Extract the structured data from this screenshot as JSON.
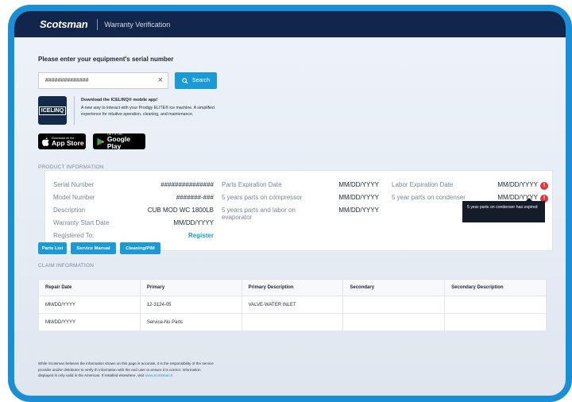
{
  "header": {
    "logo": "Scotsman",
    "title": "Warranty Verification"
  },
  "search": {
    "prompt": "Please enter your equipment's serial number",
    "value": "##############",
    "clear_icon": "×",
    "button_label": "Search"
  },
  "promo": {
    "logo_text": "ICELINQ",
    "title": "Download the ICELINQ® mobile app!",
    "text": "A new way to interact with your Prodigy ELITE® ice machine. A simplified experience for intuitive operation, cleaning, and maintenance.",
    "app_store_small": "Download on the",
    "app_store_big": "App Store",
    "google_small": "GET IT ON",
    "google_big": "Google Play"
  },
  "product": {
    "section_label": "PRODUCT INFORMATION",
    "col1": [
      {
        "label": "Serial Number",
        "value": "###############"
      },
      {
        "label": "Model Number",
        "value": "#######-###"
      },
      {
        "label": "Description",
        "value": "CUB MOD WC 1800LB"
      },
      {
        "label": "Warranty Start Date",
        "value": "MM/DD/YYYY"
      },
      {
        "label": "Registered To:",
        "value": "Register"
      }
    ],
    "col2": [
      {
        "label": "Parts Expiration Date",
        "value": "MM/DD/YYYY"
      },
      {
        "label": "5 years parts on compressor",
        "value": "MM/DD/YYYY"
      },
      {
        "label": "5 years parts and labor on",
        "label2": "evaporator",
        "value": "MM/DD/YYYY"
      }
    ],
    "col3": [
      {
        "label": "Labor Expiration Date",
        "value": "MM/DD/YYYY"
      },
      {
        "label": "5 year parts on condenser",
        "value": "MM/DD/YYYY"
      }
    ],
    "alert_icon": "!",
    "tooltip": "5 year parts on condenser has expired",
    "alert_color": "#e0353a"
  },
  "doc_buttons": [
    "Parts List",
    "Service Manual",
    "Cleaning/PIM"
  ],
  "claims": {
    "section_label": "CLAIM INFORMATION",
    "headers": [
      "Repair Date",
      "Primary",
      "Primary Description",
      "Secondary",
      "Secondary Description"
    ],
    "rows": [
      [
        "MM/DD/YYYY",
        "12-3124-05",
        "VALVE-WATER INLET",
        "",
        ""
      ],
      [
        "MM/DD/YYYY",
        "Service-No Parts",
        "",
        "",
        ""
      ]
    ]
  },
  "footer": {
    "line1": "While Scotsman believes the information shown on this page is accurate, it is the responsibility of the service",
    "line2": "provider and/or distributor to verify th information with the end user to ensure it is correct. Information",
    "line3": "displayed is only valid in the Americas. If installed elsewhere, visit ",
    "link": "www.Scotsman.it"
  },
  "colors": {
    "accent": "#1a9bd8",
    "header_bg": "#12254a",
    "frame": "#1a8fd6"
  }
}
